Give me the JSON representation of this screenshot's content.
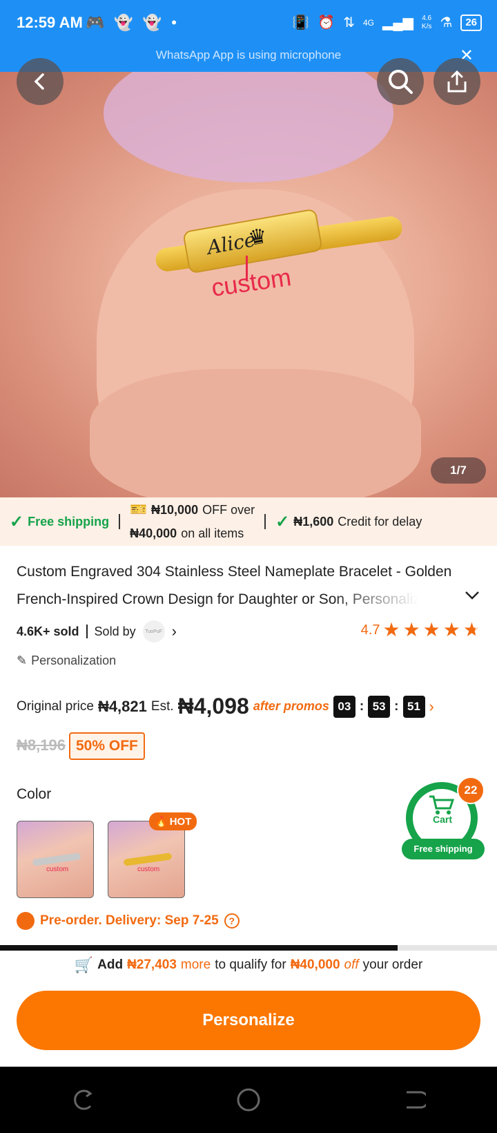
{
  "status_bar": {
    "time": "12:59 AM",
    "network_speed": "4.6",
    "network_unit": "K/s",
    "network_type": "4G",
    "battery": "26",
    "banner": "WhatsApp App is using microphone"
  },
  "hero": {
    "engraved_name": "Alice",
    "annotation": "custom",
    "image_counter": "1/7"
  },
  "promo": {
    "free_shipping": "Free shipping",
    "discount_amount": "₦10,000",
    "discount_text_1": "OFF over",
    "discount_threshold": "₦40,000",
    "discount_text_2": "on all items",
    "credit_amount": "₦1,600",
    "credit_text": "Credit for delay"
  },
  "product": {
    "title": "Custom Engraved 304 Stainless Steel Nameplate Bracelet - Golden French-Inspired Crown Design for Daughter or Son, Personalized",
    "sold": "4.6K+ sold",
    "sold_by_label": "Sold by",
    "seller_logo": "TuoPuF",
    "rating": "4.7",
    "rating_value": 4.7,
    "personalization_label": "Personalization"
  },
  "price": {
    "original_label": "Original price",
    "original_value": "₦4,821",
    "est_label": "Est.",
    "est_value": "₦4,098",
    "after_promos": "after promos",
    "timer_hours": "03",
    "timer_minutes": "53",
    "timer_seconds": "51",
    "old_price": "₦8,196",
    "discount_badge": "50% OFF"
  },
  "color": {
    "label": "Color",
    "options": [
      {
        "name": "silver",
        "swatch_text": "custom"
      },
      {
        "name": "gold",
        "swatch_text": "custom"
      }
    ],
    "hot_badge": "HOT"
  },
  "cart": {
    "label": "Cart",
    "count": "22",
    "free_shipping": "Free shipping"
  },
  "delivery": {
    "text": "Pre-order. Delivery: Sep 7-25"
  },
  "qualify": {
    "prefix": "Add",
    "amount": "₦27,403",
    "more": "more",
    "middle": "to qualify for",
    "target": "₦40,000",
    "off": "off",
    "suffix": "your order",
    "progress": 0.8
  },
  "cta": {
    "label": "Personalize"
  },
  "colors": {
    "status_bar": "#1e90f5",
    "accent_orange": "#fb7701",
    "accent_green": "#16a34a"
  }
}
